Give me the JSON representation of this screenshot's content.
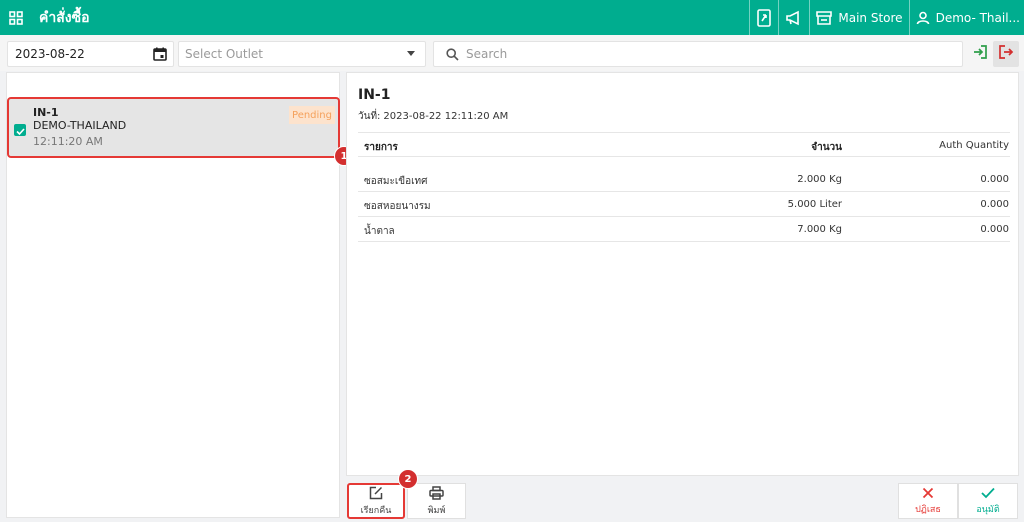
{
  "header": {
    "title": "คำสั่งซื้อ",
    "store": "Main Store",
    "user": "Demo- Thail...",
    "icons": [
      "grid-icon",
      "tablet-icon",
      "megaphone-icon",
      "store-icon",
      "user-icon"
    ]
  },
  "filters": {
    "date": "2023-08-22",
    "outlet_placeholder": "Select Outlet",
    "search_placeholder": "Search"
  },
  "order_list": [
    {
      "id": "IN-1",
      "outlet": "DEMO-THAILAND",
      "time": "12:11:20 AM",
      "status": "Pending",
      "checked": true
    }
  ],
  "detail": {
    "id": "IN-1",
    "date_label": "วันที่:",
    "date_value": "2023-08-22 12:11:20 AM",
    "columns": {
      "name": "รายการ",
      "qty": "จำนวน",
      "auth_qty": "Auth Quantity"
    },
    "rows": [
      {
        "name": "ซอสมะเขือเทศ",
        "qty": "2.000 Kg",
        "auth_qty": "0.000"
      },
      {
        "name": "ซอสหอยนางรม",
        "qty": "5.000 Liter",
        "auth_qty": "0.000"
      },
      {
        "name": "น้ำตาล",
        "qty": "7.000 Kg",
        "auth_qty": "0.000"
      }
    ]
  },
  "actions": {
    "recall": "เรียกคืน",
    "print": "พิมพ์",
    "reject": "ปฏิเสธ",
    "approve": "อนุมัติ"
  },
  "annotations": {
    "step1": "1",
    "step2": "2"
  },
  "colors": {
    "accent": "#00ad8f",
    "danger": "#e53935",
    "pending_bg": "#fde3cd",
    "pending_text": "#f5a15c"
  }
}
